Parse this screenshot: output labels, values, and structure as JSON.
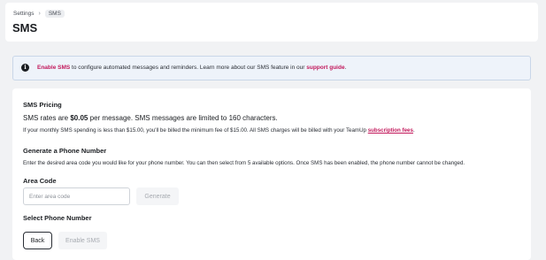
{
  "breadcrumb": {
    "items": [
      "Settings",
      "SMS"
    ],
    "separator": "›"
  },
  "page": {
    "title": "SMS"
  },
  "info_banner": {
    "icon": "info-icon",
    "link_enable": "Enable SMS",
    "text_middle": " to configure automated messages and reminders. Learn more about our SMS feature in our ",
    "link_guide": "support guide",
    "text_end": "."
  },
  "pricing": {
    "heading": "SMS Pricing",
    "rates_prefix": "SMS rates are ",
    "rates_amount": "$0.05",
    "rates_suffix": " per message. SMS messages are limited to 160 characters.",
    "minimum_text": "If your monthly SMS spending is less than $15.00, you'll be billed the minimum fee of $15.00. All SMS charges will be billed with your TeamUp ",
    "minimum_link": "subscription fees",
    "minimum_end": "."
  },
  "generate": {
    "heading": "Generate a Phone Number",
    "description": "Enter the desired area code you would like for your phone number. You can then select from 5 available options. Once SMS has been enabled, the phone number cannot be changed.",
    "area_code_label": "Area Code",
    "area_code_placeholder": "Enter area code",
    "area_code_value": "",
    "generate_button": "Generate"
  },
  "select": {
    "heading": "Select Phone Number"
  },
  "actions": {
    "back_button": "Back",
    "enable_button": "Enable SMS"
  },
  "colors": {
    "accent_link": "#c2185b",
    "banner_bg": "#eef3fa",
    "banner_border": "#c9d6e8",
    "page_bg": "#f1f2f4",
    "disabled_text": "#a7abb1"
  }
}
